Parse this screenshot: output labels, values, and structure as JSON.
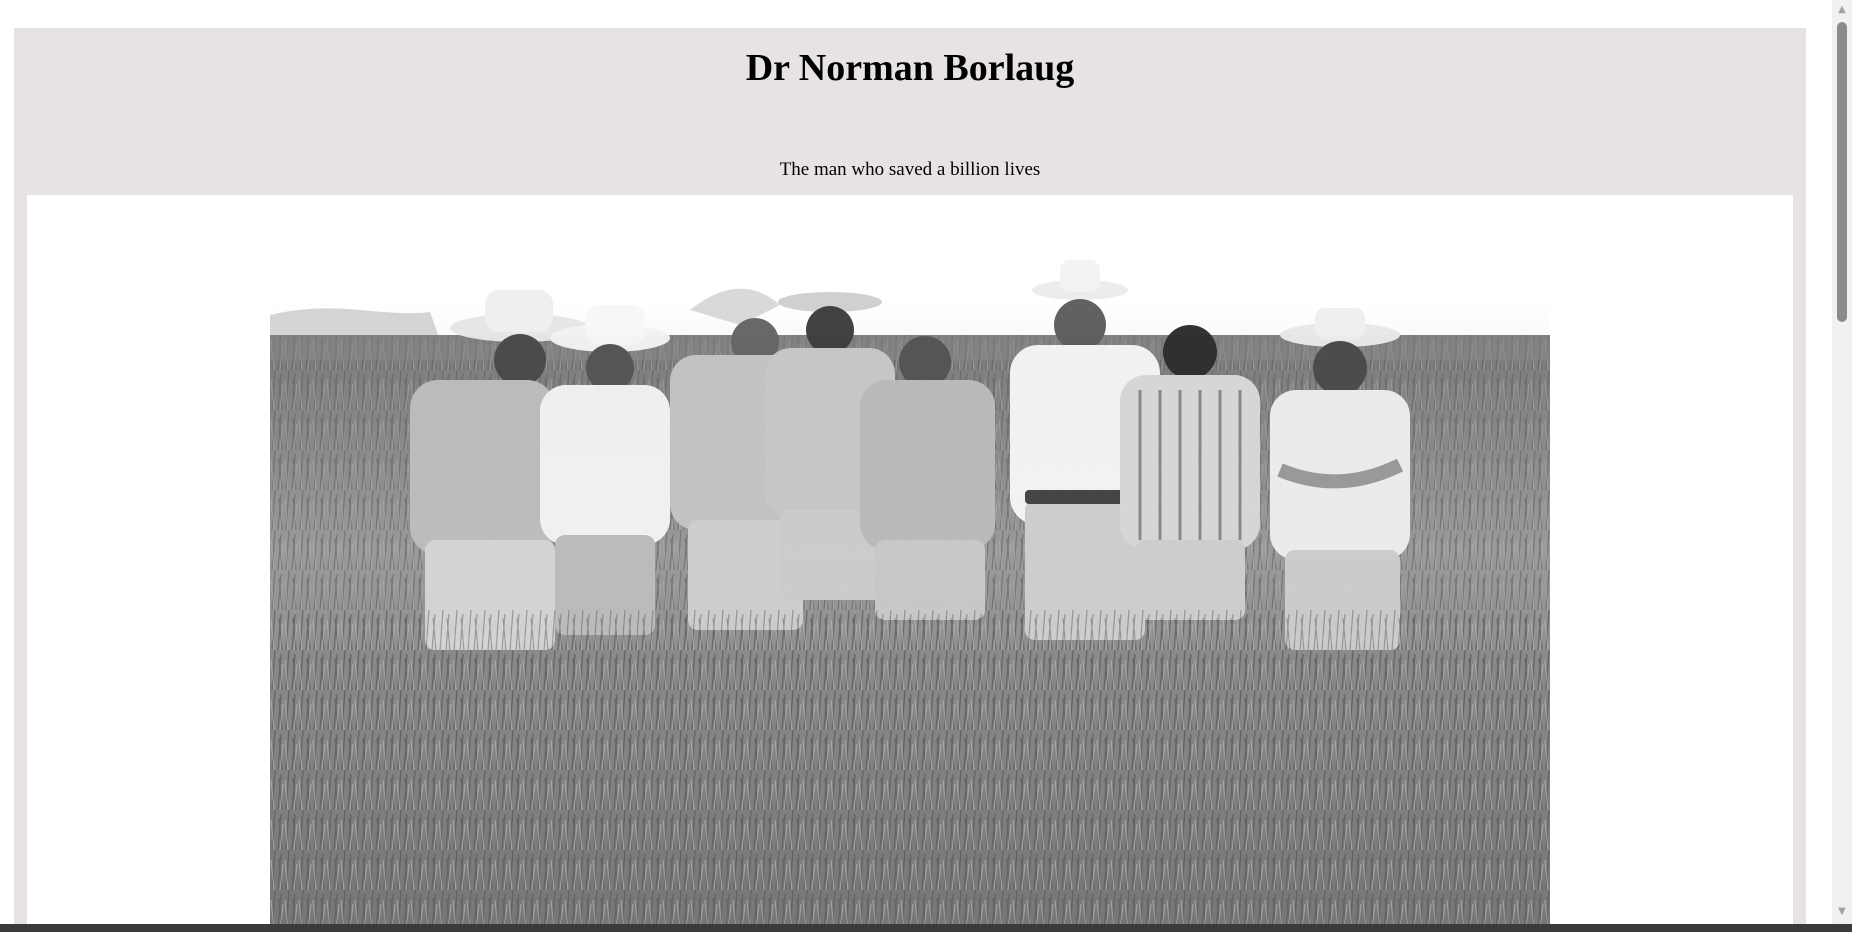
{
  "page": {
    "title": "Dr Norman Borlaug",
    "subtitle": "The man who saved a billion lives"
  },
  "image": {
    "alt": "Black and white photo of eight men in hats standing in a wheat field"
  },
  "scrollbar": {
    "up_icon": "▲",
    "down_icon": "▼"
  },
  "colors": {
    "header_background": "#e8e3e3",
    "panel_background": "#ffffff"
  }
}
